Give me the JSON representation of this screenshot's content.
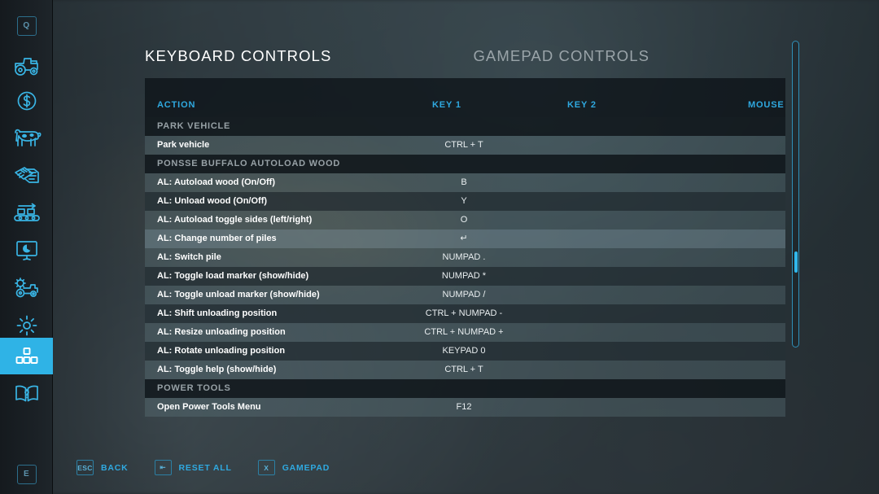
{
  "colors": {
    "accent": "#2fa9e0",
    "accent_bright": "#31b8ec",
    "sidebar_active_bg": "#2fb3e6",
    "text_primary": "#ffffff",
    "text_muted": "#97a1a6"
  },
  "sidebar": {
    "items": [
      {
        "label": "Q",
        "icon": "q-keycap-icon",
        "active": false
      },
      {
        "label": "Vehicles",
        "icon": "tractor-icon",
        "active": false
      },
      {
        "label": "Finances",
        "icon": "dollar-coin-icon",
        "active": false
      },
      {
        "label": "Animals",
        "icon": "cow-icon",
        "active": false
      },
      {
        "label": "Contracts",
        "icon": "documents-icon",
        "active": false
      },
      {
        "label": "Production",
        "icon": "conveyor-icon",
        "active": false
      },
      {
        "label": "Statistics",
        "icon": "presentation-chart-icon",
        "active": false
      },
      {
        "label": "Vehicle Settings",
        "icon": "gear-tractor-icon",
        "active": false
      },
      {
        "label": "Game Settings",
        "icon": "gear-icon",
        "active": false
      },
      {
        "label": "Controls",
        "icon": "controls-blocks-icon",
        "active": true
      },
      {
        "label": "Help",
        "icon": "help-book-icon",
        "active": false
      }
    ],
    "bottom_key": {
      "label": "E",
      "icon": "e-keycap-icon"
    }
  },
  "tabs": [
    {
      "id": "keyboard",
      "label": "KEYBOARD CONTROLS",
      "active": true
    },
    {
      "id": "gamepad",
      "label": "GAMEPAD CONTROLS",
      "active": false
    }
  ],
  "table": {
    "headers": {
      "action": "ACTION",
      "key1": "KEY 1",
      "key2": "KEY 2",
      "mouse": "MOUSE"
    },
    "rows": [
      {
        "type": "group",
        "action": "PARK VEHICLE",
        "key1": "",
        "key2": "",
        "mouse": ""
      },
      {
        "type": "entry",
        "style": "odd",
        "action": "Park vehicle",
        "key1": "CTRL + T",
        "key2": "",
        "mouse": ""
      },
      {
        "type": "group",
        "action": "PONSSE BUFFALO AUTOLOAD WOOD",
        "key1": "",
        "key2": "",
        "mouse": ""
      },
      {
        "type": "entry",
        "style": "odd",
        "action": "AL: Autoload wood (On/Off)",
        "key1": "B",
        "key2": "",
        "mouse": ""
      },
      {
        "type": "entry",
        "style": "even",
        "action": "AL: Unload wood (On/Off)",
        "key1": "Y",
        "key2": "",
        "mouse": ""
      },
      {
        "type": "entry",
        "style": "odd",
        "action": "AL: Autoload toggle sides (left/right)",
        "key1": "O",
        "key2": "",
        "mouse": ""
      },
      {
        "type": "entry",
        "style": "sel",
        "action": "AL: Change number of piles",
        "key1": "↵",
        "key2": "",
        "mouse": ""
      },
      {
        "type": "entry",
        "style": "odd",
        "action": "AL: Switch pile",
        "key1": "NUMPAD .",
        "key2": "",
        "mouse": ""
      },
      {
        "type": "entry",
        "style": "even",
        "action": "AL: Toggle load marker (show/hide)",
        "key1": "NUMPAD *",
        "key2": "",
        "mouse": ""
      },
      {
        "type": "entry",
        "style": "odd",
        "action": "AL: Toggle unload marker (show/hide)",
        "key1": "NUMPAD /",
        "key2": "",
        "mouse": ""
      },
      {
        "type": "entry",
        "style": "even",
        "action": "AL: Shift unloading position",
        "key1": "CTRL + NUMPAD -",
        "key2": "",
        "mouse": ""
      },
      {
        "type": "entry",
        "style": "odd",
        "action": "AL: Resize unloading position",
        "key1": "CTRL + NUMPAD +",
        "key2": "",
        "mouse": ""
      },
      {
        "type": "entry",
        "style": "even",
        "action": "AL: Rotate unloading position",
        "key1": "KEYPAD 0",
        "key2": "",
        "mouse": ""
      },
      {
        "type": "entry",
        "style": "odd",
        "action": "AL: Toggle help (show/hide)",
        "key1": "CTRL + T",
        "key2": "",
        "mouse": ""
      },
      {
        "type": "group",
        "action": "POWER TOOLS",
        "key1": "",
        "key2": "",
        "mouse": ""
      },
      {
        "type": "entry",
        "style": "odd",
        "action": "Open Power Tools Menu",
        "key1": "F12",
        "key2": "",
        "mouse": ""
      }
    ]
  },
  "scrollbar": {
    "thumb_position_percent": 74
  },
  "footer": {
    "hints": [
      {
        "key": "ESC",
        "icon": "esc-key-icon",
        "label": "BACK"
      },
      {
        "key": "⇤",
        "icon": "backspace-key-icon",
        "label": "RESET ALL"
      },
      {
        "key": "X",
        "icon": "x-key-icon",
        "label": "GAMEPAD"
      }
    ]
  }
}
